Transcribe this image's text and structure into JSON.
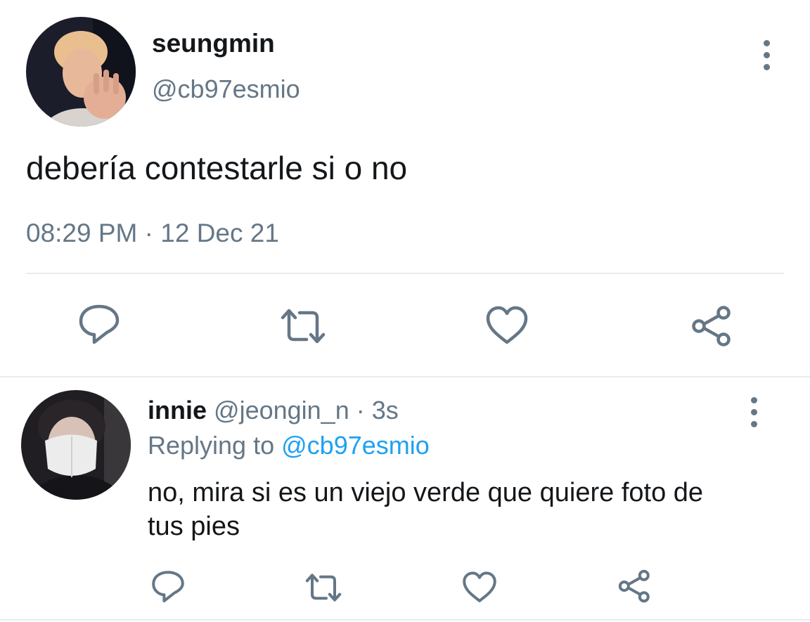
{
  "tweet": {
    "display_name": "seungmin",
    "handle": "@cb97esmio",
    "text": "debería contestarle si o no",
    "time": "08:29 PM",
    "separator": "·",
    "date": "12 Dec 21",
    "avatar_icon": "profile-photo",
    "actions": [
      "reply-icon",
      "retweet-icon",
      "like-icon",
      "share-icon"
    ]
  },
  "reply": {
    "display_name": "innie",
    "handle": "@jeongin_n",
    "separator": "·",
    "age": "3s",
    "replying_prefix": "Replying to",
    "replying_handle": "@cb97esmio",
    "text_line1": "no, mira si es un viejo verde que quiere foto de",
    "text_line2": "tus pies",
    "avatar_icon": "profile-photo",
    "actions": [
      "reply-icon",
      "retweet-icon",
      "like-icon",
      "share-icon"
    ]
  },
  "colors": {
    "text": "#14171a",
    "muted": "#657786",
    "link": "#1da1f2",
    "divider": "#e6ecf0"
  }
}
